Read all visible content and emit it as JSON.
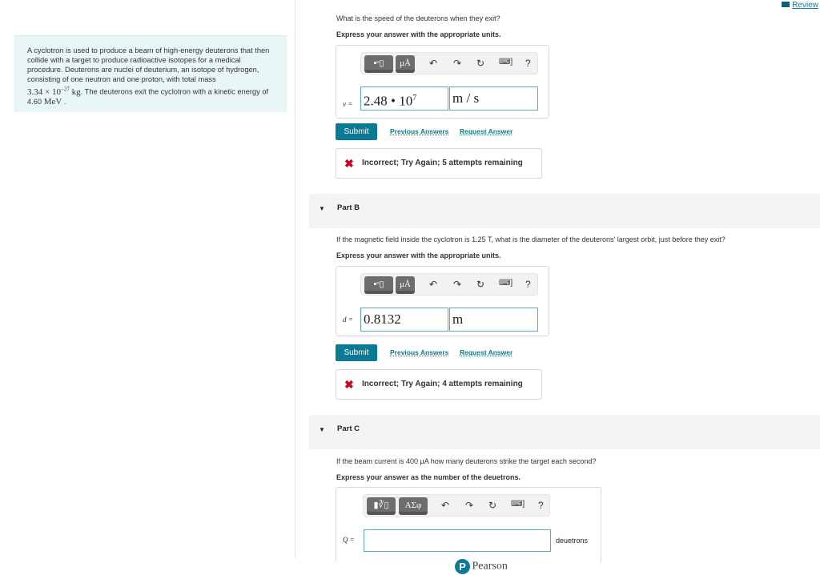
{
  "header": {
    "review_link": "Review",
    "review_icon": "book-icon"
  },
  "intro": {
    "text1": "A cyclotron is used to produce a beam of high-energy deuterons that then collide with a target to produce radioactive isotopes for a medical procedure. Deuterons are nuclei of deuterium, an isotope of hydrogen, consisting of one neutron and one proton, with total mass",
    "mass": "3.34 × 10",
    "mass_exp": "−27",
    "mass_unit": "kg",
    "text2": ". The deuterons exit the cyclotron with a kinetic energy of 4.60 ",
    "energy_unit": "MeV",
    "text3": "."
  },
  "toolbar": {
    "undo": "↶",
    "redo": "↷",
    "reset": "↻",
    "keyboard": "⌨]",
    "help": "?",
    "units_btn": "μÅ",
    "greek_btn": "ΑΣφ"
  },
  "partA": {
    "question": "What is the speed of the deuterons when they exit?",
    "instruction": "Express your answer with the appropriate units.",
    "var": "v =",
    "value": "2.48 • 10",
    "exp": "7",
    "unit": "m / s",
    "submit": "Submit",
    "prev": "Previous Answers",
    "request": "Request Answer",
    "feedback": "Incorrect; Try Again; 5 attempts remaining"
  },
  "partB": {
    "title": "Part B",
    "question": "If the magnetic field inside the cyclotron is 1.25 T, what is the diameter of the deuterons' largest orbit, just before they exit?",
    "instruction": "Express your answer with the appropriate units.",
    "var": "d =",
    "value": "0.8132",
    "unit": "m",
    "submit": "Submit",
    "prev": "Previous Answers",
    "request": "Request Answer",
    "feedback": "Incorrect; Try Again; 4 attempts remaining"
  },
  "partC": {
    "title": "Part C",
    "question": "If the beam current is 400 μA how many deuterons strike the target each second?",
    "instruction": "Express your answer as the number of the deuetrons.",
    "var": "Q =",
    "value": "",
    "unit": "deuetrons"
  },
  "footer": {
    "brand": "Pearson"
  },
  "colors": {
    "accent": "#0b7a94",
    "error": "#d0021b",
    "intro_bg": "#e9f6f8"
  }
}
